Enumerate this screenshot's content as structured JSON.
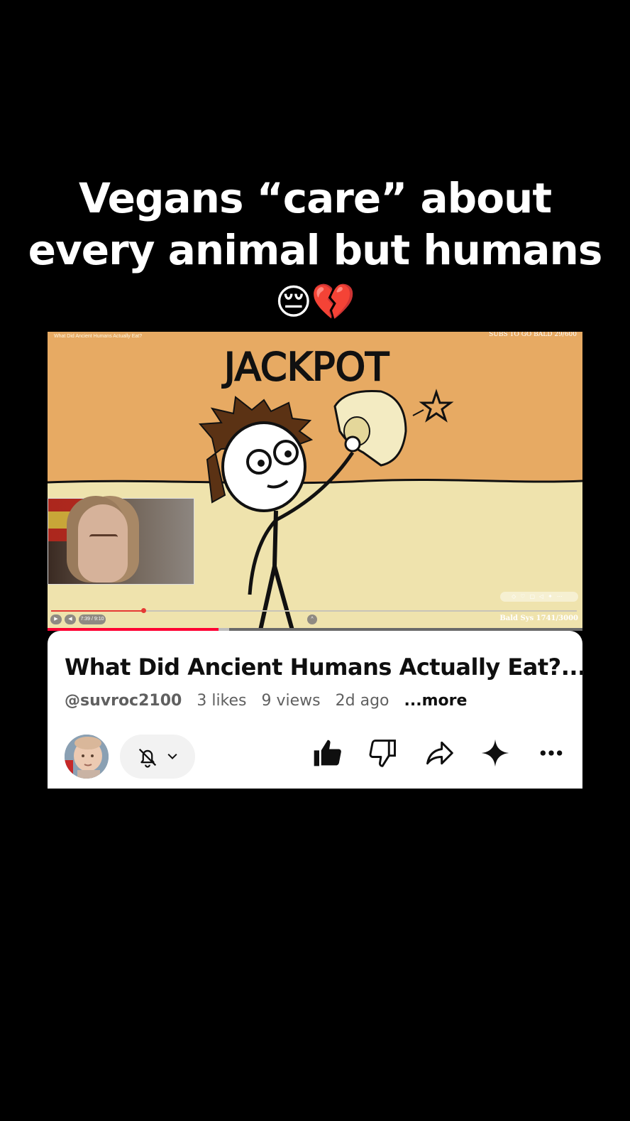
{
  "caption": {
    "line1": "Vegans “care” about",
    "line2": "every animal but humans",
    "emoji": "😔💔"
  },
  "video": {
    "overlay_title": "What Did Ancient Humans Actually Eat?",
    "subs_goal": "SUBS TO GO BALD 29/600",
    "drawing_text": "JACKPOT",
    "time_display": "7:39 / 9:10",
    "sub_counter": "Bald Sys 1741/3000",
    "progress_fraction": 0.32,
    "buffer_fraction": 0.34
  },
  "card": {
    "title": "What Did Ancient Humans Actually Eat?...",
    "handle": "@suvroc2100",
    "likes": "3 likes",
    "views": "9 views",
    "age": "2d ago",
    "more": "...more"
  },
  "icons": {
    "bell": "bell-off-icon",
    "chevron": "chevron-down-icon",
    "like": "thumbs-up-icon",
    "dislike": "thumbs-down-icon",
    "share": "share-icon",
    "remix": "sparkle-icon",
    "menu": "more-horizontal-icon"
  },
  "colors": {
    "background": "#000000",
    "video_sky": "#e7aa63",
    "video_sand": "#efe3ad",
    "progress": "#ff0033",
    "card": "#ffffff"
  }
}
